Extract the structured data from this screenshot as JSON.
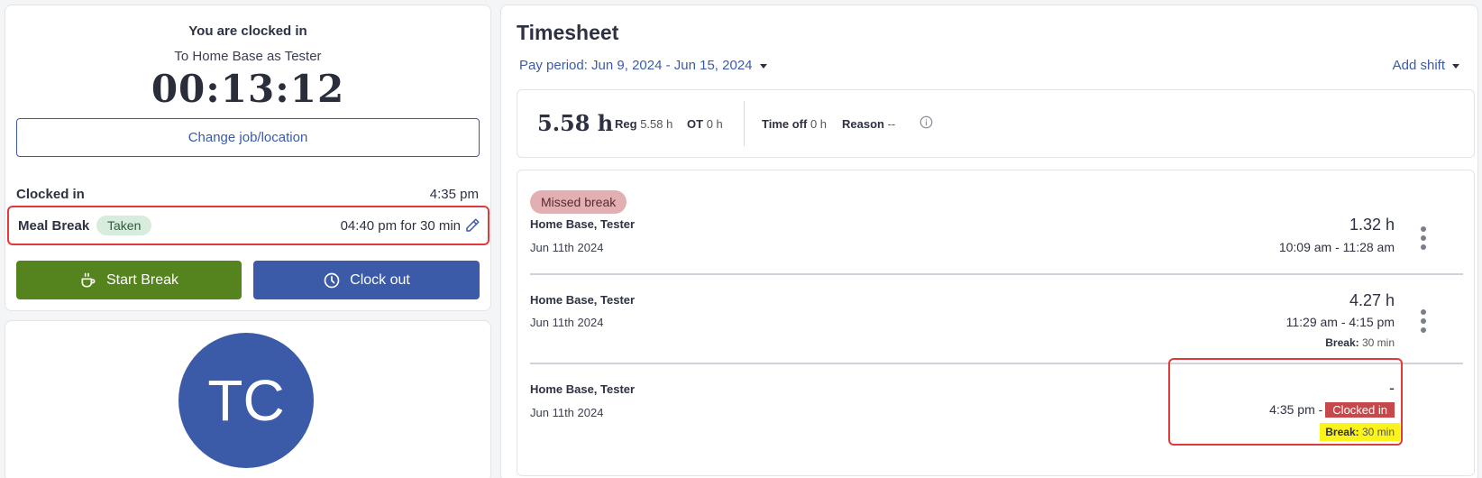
{
  "clock": {
    "status": "You are clocked in",
    "location": "To Home Base as Tester",
    "timer": "00:13:12",
    "change_job_label": "Change job/location",
    "clocked_in_label": "Clocked in",
    "clocked_in_time": "4:35 pm",
    "meal_break_label": "Meal Break",
    "meal_break_status": "Taken",
    "meal_break_time": "04:40 pm for 30 min",
    "start_break_label": "Start Break",
    "clock_out_label": "Clock out"
  },
  "profile": {
    "initials": "TC"
  },
  "timesheet": {
    "title": "Timesheet",
    "pay_period": "Pay period: Jun 9, 2024 - Jun 15, 2024",
    "add_shift_label": "Add shift",
    "summary": {
      "total_hours": "5.58 h",
      "reg_label": "Reg",
      "reg_value": "5.58 h",
      "ot_label": "OT",
      "ot_value": "0 h",
      "time_off_label": "Time off",
      "time_off_value": "0 h",
      "reason_label": "Reason",
      "reason_value": "--"
    },
    "missed_break_label": "Missed break",
    "break_label": "Break:",
    "shifts": [
      {
        "location": "Home Base, Tester",
        "date": "Jun 11th 2024",
        "hours": "1.32 h",
        "range": "10:09 am - 11:28 am"
      },
      {
        "location": "Home Base, Tester",
        "date": "Jun 11th 2024",
        "hours": "4.27 h",
        "range": "11:29 am - 4:15 pm",
        "break_value": "30 min"
      },
      {
        "location": "Home Base, Tester",
        "date": "Jun 11th 2024",
        "hours": "-",
        "range_start": "4:35 pm -",
        "clocked_in_badge": "Clocked in",
        "break_value": "30 min"
      }
    ]
  },
  "colors": {
    "primary_blue": "#3b5ba9",
    "start_break_green": "#55841f",
    "clocked_in_red": "#c7484b",
    "highlight_yellow": "#fbf31a",
    "annotation_red": "#e23a3a"
  }
}
